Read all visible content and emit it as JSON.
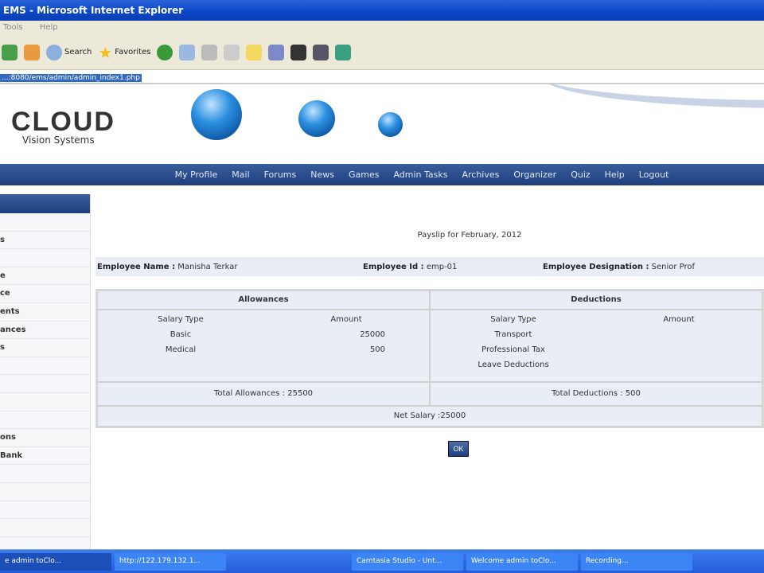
{
  "window": {
    "title": "EMS - Microsoft Internet Explorer"
  },
  "menu": [
    "Tools",
    "Help"
  ],
  "toolbar": {
    "search": "Search",
    "favorites": "Favorites"
  },
  "address": "...:8080/ems/admin/admin_index1.php",
  "logo": {
    "name": "CLOUD",
    "tagline": "Vision Systems"
  },
  "nav": [
    "My Profile",
    "Mail",
    "Forums",
    "News",
    "Games",
    "Admin Tasks",
    "Archives",
    "Organizer",
    "Quiz",
    "Help",
    "Logout"
  ],
  "sidebar": [
    "",
    "s",
    "",
    "e",
    "ce",
    "ents",
    "ances",
    "s",
    "",
    "",
    "",
    "",
    "ons",
    "Bank",
    "",
    "",
    "",
    "",
    "",
    ""
  ],
  "payslip": {
    "title": "Payslip for February, 2012",
    "emp_name_label": "Employee Name :",
    "emp_name": "Manisha Terkar",
    "emp_id_label": "Employee Id :",
    "emp_id": "emp-01",
    "emp_desig_label": "Employee Designation :",
    "emp_desig": "Senior Prof",
    "allowances": {
      "title": "Allowances",
      "col_type": "Salary Type",
      "col_amount": "Amount",
      "rows": [
        {
          "type": "Basic",
          "amount": "25000"
        },
        {
          "type": "Medical",
          "amount": "500"
        }
      ],
      "total": "Total Allowances : 25500"
    },
    "deductions": {
      "title": "Deductions",
      "col_type": "Salary Type",
      "col_amount": "Amount",
      "rows": [
        {
          "type": "Transport",
          "amount": ""
        },
        {
          "type": "Professional Tax",
          "amount": ""
        },
        {
          "type": "Leave Deductions",
          "amount": ""
        }
      ],
      "total": "Total Deductions : 500"
    },
    "net": "Net Salary :25000",
    "ok": "OK"
  },
  "taskbar": [
    "e admin toClo...",
    "http://122.179.132.1...",
    "Camtasia Studio - Unt...",
    "Welcome admin toClo...",
    "Recording..."
  ]
}
